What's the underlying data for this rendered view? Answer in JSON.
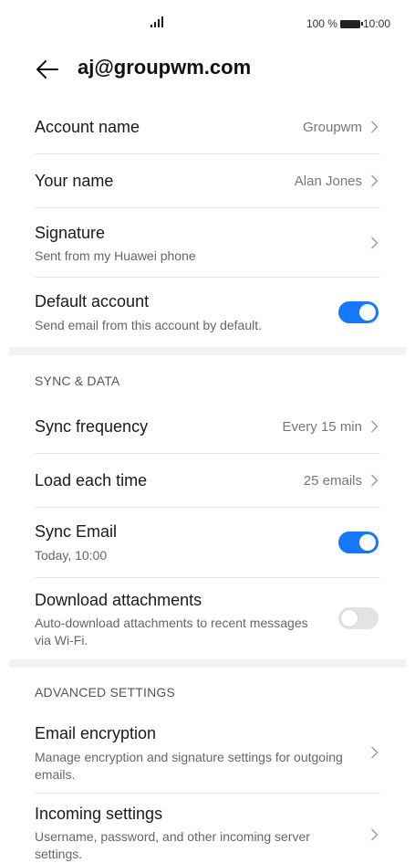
{
  "status_bar": {
    "battery_percent": "100 %",
    "time": "10:00"
  },
  "header": {
    "title": "aj@groupwm.com"
  },
  "account": {
    "account_name": {
      "title": "Account name",
      "value": "Groupwm"
    },
    "your_name": {
      "title": "Your name",
      "value": "Alan Jones"
    },
    "signature": {
      "title": "Signature",
      "subtitle": "Sent from my Huawei phone"
    },
    "default_account": {
      "title": "Default account",
      "subtitle": "Send email from this account by default.",
      "enabled": true
    }
  },
  "sync_section": {
    "header": "SYNC & DATA",
    "sync_frequency": {
      "title": "Sync frequency",
      "value": "Every 15 min"
    },
    "load_each_time": {
      "title": "Load each time",
      "value": "25 emails"
    },
    "sync_email": {
      "title": "Sync Email",
      "subtitle": "Today, 10:00",
      "enabled": true
    },
    "download_attachments": {
      "title": "Download attachments",
      "subtitle": "Auto-download attachments to recent messages via Wi-Fi.",
      "enabled": false
    }
  },
  "advanced_section": {
    "header": "ADVANCED SETTINGS",
    "email_encryption": {
      "title": "Email encryption",
      "subtitle": "Manage encryption and signature settings for outgoing emails."
    },
    "incoming_settings": {
      "title": "Incoming settings",
      "subtitle": "Username, password, and other incoming server settings."
    }
  },
  "colors": {
    "accent": "#1677ff",
    "toggle_off": "#e3e3e3",
    "divider": "#f2f2f2"
  }
}
